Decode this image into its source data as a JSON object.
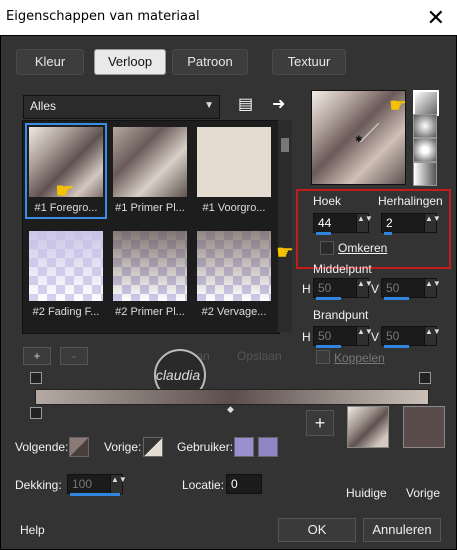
{
  "window": {
    "title": "Eigenschappen van materiaal",
    "close_label": "✕"
  },
  "tabs": [
    {
      "label": "Kleur",
      "active": false
    },
    {
      "label": "Verloop",
      "active": true
    },
    {
      "label": "Patroon",
      "active": false
    },
    {
      "label": "Textuur",
      "active": false
    }
  ],
  "library": {
    "filter_value": "Alles",
    "items": [
      {
        "label": "#1 Foregro...",
        "selected": true
      },
      {
        "label": "#1 Primer Pl...",
        "selected": false
      },
      {
        "label": "#1 Voorgro...",
        "selected": false
      },
      {
        "label": "#2 Fading F...",
        "selected": false
      },
      {
        "label": "#2 Primer Pl...",
        "selected": false
      },
      {
        "label": "#2 Vervage...",
        "selected": false
      }
    ],
    "add_label": "+",
    "remove_label": "-",
    "ghost_left": "Opslaan",
    "ghost_right": "Opslaan"
  },
  "angle": {
    "label": "Hoek",
    "value": "44"
  },
  "repeats": {
    "label": "Herhalingen",
    "value": "2"
  },
  "invert": {
    "label": "Omkeren"
  },
  "midpoint": {
    "label": "Middelpunt",
    "h_label": "H",
    "h_value": "50",
    "v_label": "V",
    "v_value": "50"
  },
  "focal": {
    "label": "Brandpunt",
    "h_label": "H",
    "h_value": "50",
    "v_label": "V",
    "v_value": "50"
  },
  "link": {
    "label": "Koppelen"
  },
  "stops": {
    "next_label": "Volgende:",
    "prev_label": "Vorige:",
    "user_label": "Gebruiker:",
    "opacity_label": "Dekking:",
    "opacity_value": "100",
    "location_label": "Locatie:",
    "location_value": "0"
  },
  "watermark_text": "claudia",
  "current_label": "Huidige",
  "previous_label": "Vorige",
  "help_label": "Help",
  "ok_label": "OK",
  "cancel_label": "Annuleren",
  "colors": {
    "accent": "#2f85e0",
    "highlight": "#c31c1c",
    "user1": "#9b8fd2",
    "user2": "#8f86c8",
    "previous_swatch": "#5a4c4a"
  }
}
